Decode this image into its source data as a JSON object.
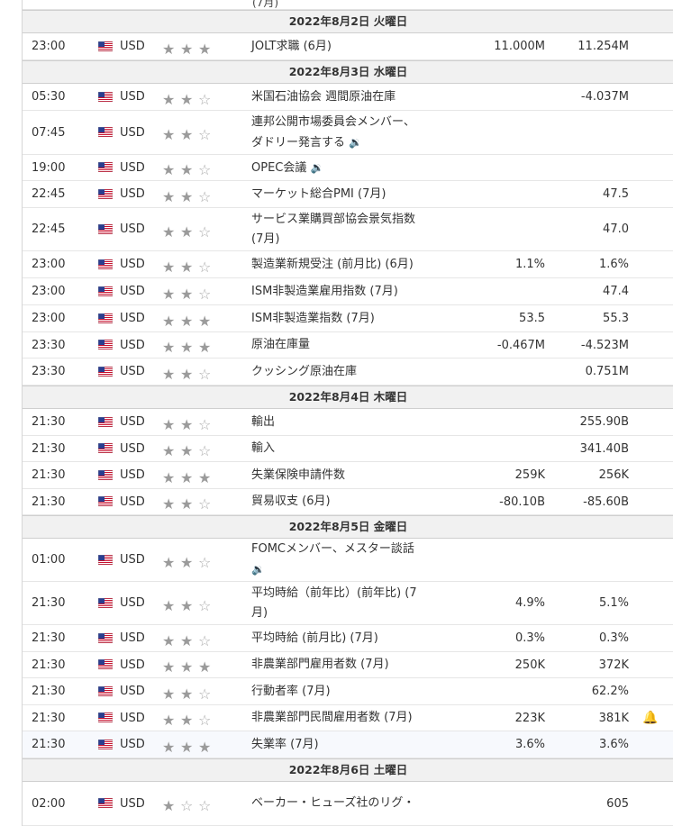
{
  "fragment_top": "(7月)",
  "sections": [
    {
      "date": "2022年8月2日 火曜日",
      "rows": [
        {
          "time": "23:00",
          "cur": "USD",
          "stars": 3,
          "lines": [
            "JOLT求職 (6月)"
          ],
          "fc": "11.000M",
          "pr": "11.254M",
          "h": 29
        }
      ]
    },
    {
      "date": "2022年8月3日 水曜日",
      "rows": [
        {
          "time": "05:30",
          "cur": "USD",
          "stars": 2,
          "lines": [
            "米国石油協会 週間原油在庫"
          ],
          "fc": "",
          "pr": "-4.037M",
          "h": 29
        },
        {
          "time": "07:45",
          "cur": "USD",
          "stars": 2,
          "lines": [
            "連邦公開市場委員会メンバー、",
            "ダドリー発言する"
          ],
          "speaker": true,
          "fc": "",
          "pr": "",
          "h": 48
        },
        {
          "time": "19:00",
          "cur": "USD",
          "stars": 2,
          "lines": [
            "OPEC会議"
          ],
          "speaker": true,
          "fc": "",
          "pr": "",
          "h": 28
        },
        {
          "time": "22:45",
          "cur": "USD",
          "stars": 2,
          "lines": [
            "マーケット総合PMI (7月)"
          ],
          "fc": "",
          "pr": "47.5",
          "h": 29
        },
        {
          "time": "22:45",
          "cur": "USD",
          "stars": 2,
          "lines": [
            "サービス業購買部協会景気指数",
            "(7月)"
          ],
          "fc": "",
          "pr": "47.0",
          "h": 47
        },
        {
          "time": "23:00",
          "cur": "USD",
          "stars": 2,
          "lines": [
            "製造業新規受注 (前月比) (6月)"
          ],
          "fc": "1.1%",
          "pr": "1.6%",
          "h": 29
        },
        {
          "time": "23:00",
          "cur": "USD",
          "stars": 2,
          "lines": [
            "ISM非製造業雇用指数 (7月)"
          ],
          "fc": "",
          "pr": "47.4",
          "h": 29
        },
        {
          "time": "23:00",
          "cur": "USD",
          "stars": 3,
          "lines": [
            "ISM非製造業指数 (7月)"
          ],
          "fc": "53.5",
          "pr": "55.3",
          "h": 29
        },
        {
          "time": "23:30",
          "cur": "USD",
          "stars": 3,
          "lines": [
            "原油在庫量"
          ],
          "fc": "-0.467M",
          "pr": "-4.523M",
          "h": 28
        },
        {
          "time": "23:30",
          "cur": "USD",
          "stars": 2,
          "lines": [
            "クッシング原油在庫"
          ],
          "fc": "",
          "pr": "0.751M",
          "h": 29
        }
      ]
    },
    {
      "date": "2022年8月4日 木曜日",
      "rows": [
        {
          "time": "21:30",
          "cur": "USD",
          "stars": 2,
          "lines": [
            "輸出"
          ],
          "fc": "",
          "pr": "255.90B",
          "h": 29
        },
        {
          "time": "21:30",
          "cur": "USD",
          "stars": 2,
          "lines": [
            "輸入"
          ],
          "fc": "",
          "pr": "341.40B",
          "h": 28
        },
        {
          "time": "21:30",
          "cur": "USD",
          "stars": 3,
          "lines": [
            "失業保険申請件数"
          ],
          "fc": "259K",
          "pr": "256K",
          "h": 29
        },
        {
          "time": "21:30",
          "cur": "USD",
          "stars": 2,
          "lines": [
            "貿易収支 (6月)"
          ],
          "fc": "-80.10B",
          "pr": "-85.60B",
          "h": 28
        }
      ]
    },
    {
      "date": "2022年8月5日 金曜日",
      "rows": [
        {
          "time": "01:00",
          "cur": "USD",
          "stars": 2,
          "lines": [
            "FOMCメンバー、メスター談話"
          ],
          "speaker2": true,
          "fc": "",
          "pr": "",
          "h": 47
        },
        {
          "time": "21:30",
          "cur": "USD",
          "stars": 2,
          "lines": [
            "平均時給（前年比）(前年比) (7",
            "月)"
          ],
          "fc": "4.9%",
          "pr": "5.1%",
          "h": 47
        },
        {
          "time": "21:30",
          "cur": "USD",
          "stars": 2,
          "lines": [
            "平均時給 (前月比) (7月)"
          ],
          "fc": "0.3%",
          "pr": "0.3%",
          "h": 29
        },
        {
          "time": "21:30",
          "cur": "USD",
          "stars": 3,
          "lines": [
            "非農業部門雇用者数 (7月)"
          ],
          "fc": "250K",
          "pr": "372K",
          "h": 28
        },
        {
          "time": "21:30",
          "cur": "USD",
          "stars": 2,
          "lines": [
            "行動者率 (7月)"
          ],
          "fc": "",
          "pr": "62.2%",
          "h": 29
        },
        {
          "time": "21:30",
          "cur": "USD",
          "stars": 2,
          "lines": [
            "非農業部門民間雇用者数 (7月)"
          ],
          "fc": "223K",
          "pr": "381K",
          "h": 28,
          "bell": true
        },
        {
          "time": "21:30",
          "cur": "USD",
          "stars": 3,
          "lines": [
            "失業率 (7月)"
          ],
          "fc": "3.6%",
          "pr": "3.6%",
          "h": 29,
          "alt": true
        }
      ]
    },
    {
      "date": "2022年8月6日 土曜日",
      "rows": [
        {
          "time": "02:00",
          "cur": "USD",
          "stars": 1,
          "lines": [
            "ベーカー・ヒューズ社のリグ・"
          ],
          "fc": "",
          "pr": "605",
          "h": 48
        }
      ]
    }
  ]
}
